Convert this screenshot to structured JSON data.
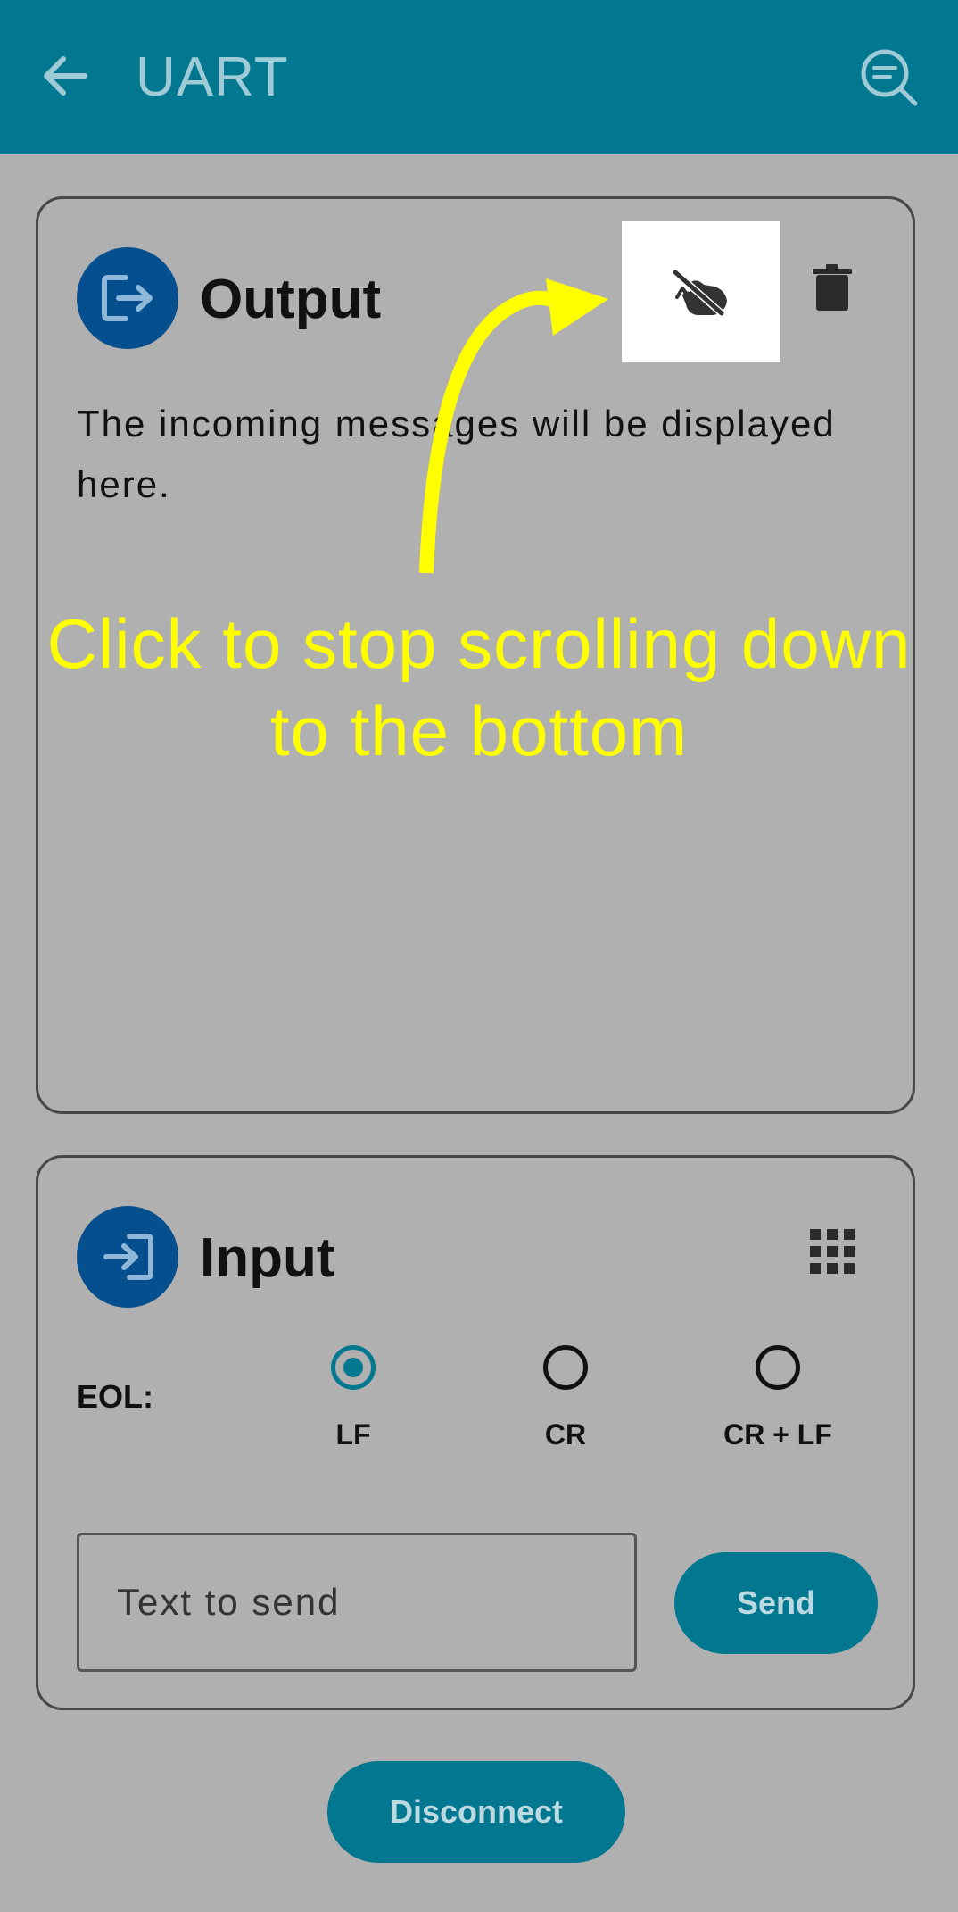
{
  "appbar": {
    "title": "UART",
    "back_icon": "arrow-back-icon",
    "search_icon": "search-icon",
    "background": "#027790"
  },
  "output": {
    "title": "Output",
    "icon": "output-exit-icon",
    "scroll_lock_icon": "touch-off-icon",
    "clear_icon": "trash-icon",
    "placeholder_text": "The incoming messages will be displayed here."
  },
  "annotation": {
    "text_line1": "Click to stop scrolling down",
    "text_line2": "to the bottom",
    "color": "#ffff00"
  },
  "input": {
    "title": "Input",
    "icon": "input-enter-icon",
    "keypad_icon": "grid-icon",
    "eol_label": "EOL:",
    "eol_options": [
      {
        "label": "LF",
        "selected": true
      },
      {
        "label": "CR",
        "selected": false
      },
      {
        "label": "CR + LF",
        "selected": false
      }
    ],
    "text_placeholder": "Text to send",
    "send_label": "Send"
  },
  "disconnect_label": "Disconnect",
  "colors": {
    "accent": "#027790",
    "icon_circle": "#064f8e",
    "background": "#b0b0b0"
  }
}
